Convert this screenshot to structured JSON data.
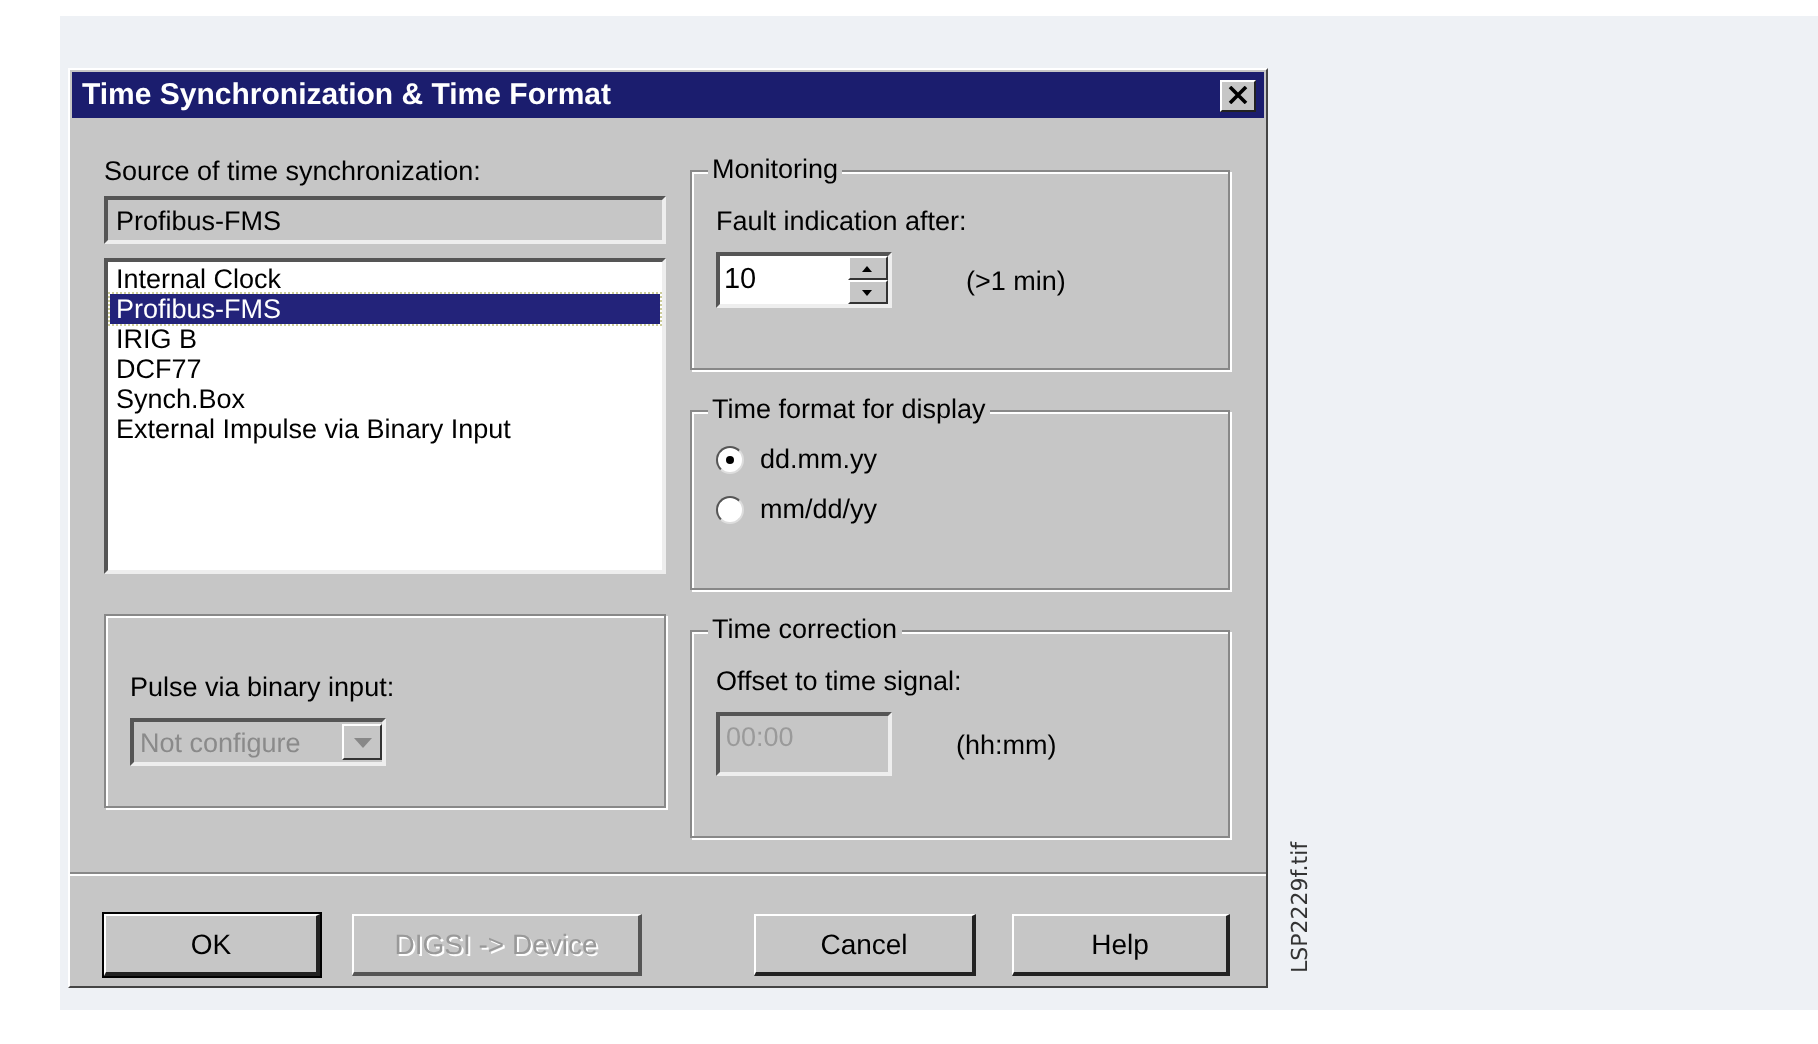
{
  "window": {
    "title": "Time Synchronization & Time Format"
  },
  "source": {
    "label": "Source of time synchronization:",
    "value": "Profibus-FMS",
    "items": [
      {
        "label": "Internal Clock",
        "selected": false
      },
      {
        "label": "Profibus-FMS",
        "selected": true
      },
      {
        "label": "IRIG B",
        "selected": false
      },
      {
        "label": "DCF77",
        "selected": false
      },
      {
        "label": "Synch.Box",
        "selected": false
      },
      {
        "label": "External Impulse via Binary Input",
        "selected": false
      }
    ]
  },
  "pulse": {
    "label": "Pulse via binary input:",
    "value": "Not configure",
    "disabled": true
  },
  "monitoring": {
    "title": "Monitoring",
    "label": "Fault indication after:",
    "value": "10",
    "unit": "(>1 min)"
  },
  "time_format": {
    "title": "Time format for display",
    "options": [
      {
        "label": "dd.mm.yy",
        "selected": true
      },
      {
        "label": "mm/dd/yy",
        "selected": false
      }
    ]
  },
  "time_correction": {
    "title": "Time correction",
    "label": "Offset to time signal:",
    "value": "00:00",
    "disabled": true,
    "unit": "(hh:mm)"
  },
  "buttons": [
    {
      "label": "OK",
      "disabled": false
    },
    {
      "label": "DIGSI -> Device",
      "disabled": true
    },
    {
      "label": "Cancel",
      "disabled": false
    },
    {
      "label": "Help",
      "disabled": false
    }
  ],
  "figure_label": "LSP2229f.tif"
}
